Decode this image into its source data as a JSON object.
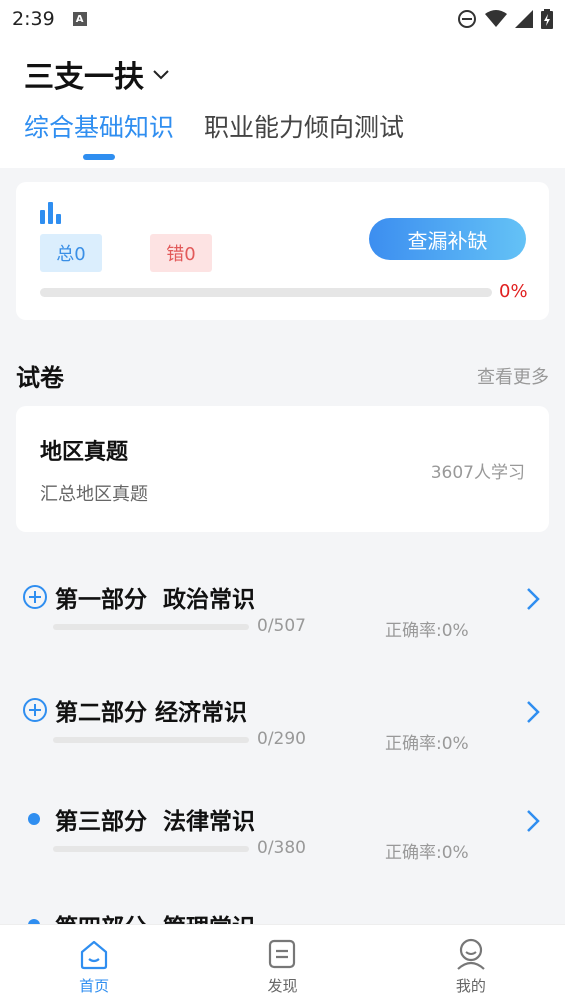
{
  "status_bar": {
    "time": "2:39",
    "notif_letter": "A"
  },
  "header": {
    "title": "三支一扶",
    "tabs": [
      {
        "label": "综合基础知识",
        "active": true
      },
      {
        "label": "职业能力倾向测试",
        "active": false
      }
    ]
  },
  "stats": {
    "total_label": "总0",
    "wrong_label": "错0",
    "fill_button": "查漏补缺",
    "progress": 0,
    "progress_label": "0%"
  },
  "papers": {
    "section_title": "试卷",
    "more_label": "查看更多",
    "card": {
      "title": "地区真题",
      "subtitle": "汇总地区真题",
      "learners": "3607人学习"
    }
  },
  "parts": [
    {
      "name": "第一部分  政治常识",
      "marker": "plus",
      "count": "0/507",
      "accuracy": "正确率:0%",
      "progress": 0
    },
    {
      "name": "第二部分 经济常识",
      "marker": "plus",
      "count": "0/290",
      "accuracy": "正确率:0%",
      "progress": 0
    },
    {
      "name": "第三部分  法律常识",
      "marker": "dot",
      "count": "0/380",
      "accuracy": "正确率:0%",
      "progress": 0
    },
    {
      "name": "第四部分  管理常识",
      "marker": "dot",
      "count": "",
      "accuracy": "",
      "progress": 0
    }
  ],
  "bottom_nav": [
    {
      "label": "首页",
      "icon": "home-icon",
      "active": true
    },
    {
      "label": "发现",
      "icon": "discover-icon",
      "active": false
    },
    {
      "label": "我的",
      "icon": "profile-icon",
      "active": false
    }
  ],
  "colors": {
    "accent": "#2f8ef0",
    "danger": "#e02020"
  }
}
